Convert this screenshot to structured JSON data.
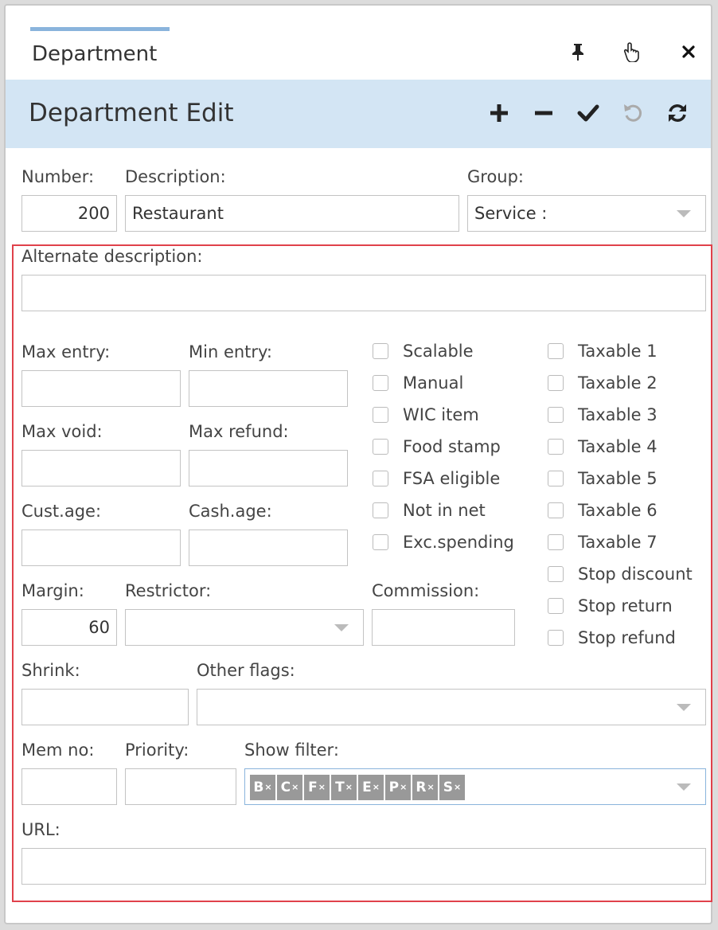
{
  "window": {
    "tab_title": "Department",
    "pin_icon": "pin-icon",
    "hand_icon": "hand-pointer-icon",
    "close_icon": "close-icon"
  },
  "header": {
    "title": "Department Edit",
    "toolbar": [
      "plus-icon",
      "minus-icon",
      "check-icon",
      "undo-icon",
      "refresh-icon"
    ]
  },
  "form": {
    "number_label": "Number:",
    "number_value": "200",
    "description_label": "Description:",
    "description_value": "Restaurant",
    "group_label": "Group:",
    "group_value": "Service :",
    "alternate_description_label": "Alternate description:",
    "max_entry_label": "Max entry:",
    "min_entry_label": "Min entry:",
    "max_void_label": "Max void:",
    "max_refund_label": "Max refund:",
    "cust_age_label": "Cust.age:",
    "cash_age_label": "Cash.age:",
    "margin_label": "Margin:",
    "margin_value": "60",
    "restrictor_label": "Restrictor:",
    "commission_label": "Commission:",
    "shrink_label": "Shrink:",
    "other_flags_label": "Other flags:",
    "mem_no_label": "Mem no:",
    "priority_label": "Priority:",
    "show_filter_label": "Show filter:",
    "show_filter_chips": [
      "B",
      "C",
      "F",
      "T",
      "E",
      "P",
      "R",
      "S"
    ],
    "chip_remove_glyph": "×",
    "url_label": "URL:"
  },
  "checkboxes_left": [
    {
      "label": "Scalable",
      "checked": false
    },
    {
      "label": "Manual",
      "checked": false
    },
    {
      "label": "WIC item",
      "checked": false
    },
    {
      "label": "Food stamp",
      "checked": false
    },
    {
      "label": "FSA eligible",
      "checked": false
    },
    {
      "label": "Not in net",
      "checked": false
    },
    {
      "label": "Exc.spending",
      "checked": false
    }
  ],
  "checkboxes_right": [
    {
      "label": "Taxable 1",
      "checked": false
    },
    {
      "label": "Taxable 2",
      "checked": false
    },
    {
      "label": "Taxable 3",
      "checked": false
    },
    {
      "label": "Taxable 4",
      "checked": false
    },
    {
      "label": "Taxable 5",
      "checked": false
    },
    {
      "label": "Taxable 6",
      "checked": false
    },
    {
      "label": "Taxable 7",
      "checked": false
    },
    {
      "label": "Stop discount",
      "checked": false
    },
    {
      "label": "Stop return",
      "checked": false
    },
    {
      "label": "Stop refund",
      "checked": false
    }
  ]
}
